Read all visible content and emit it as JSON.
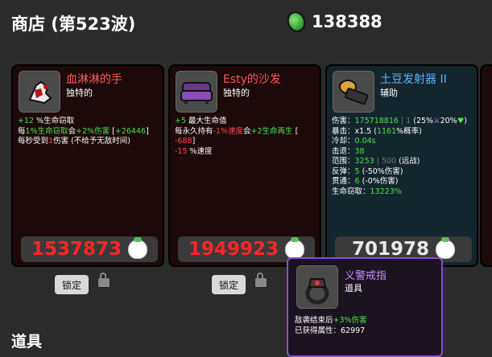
{
  "header": {
    "title": "商店 (第523波)",
    "materials": "138388"
  },
  "cards": [
    {
      "name": "血淋淋的手",
      "type": "独特的",
      "price": "1537873",
      "lines": [
        [
          {
            "t": "+12",
            "c": "g"
          },
          {
            "t": " %生命窃取"
          }
        ],
        [
          {
            "t": "每"
          },
          {
            "t": "1%生命窃取",
            "c": "g"
          },
          {
            "t": "会"
          },
          {
            "t": "+2%伤害",
            "c": "g"
          },
          {
            "t": " ["
          },
          {
            "t": "+26446",
            "c": "g"
          },
          {
            "t": "]"
          }
        ],
        [
          {
            "t": "每秒受到"
          },
          {
            "t": "1",
            "c": "r"
          },
          {
            "t": "伤害 (不给予无敌时间)"
          }
        ]
      ]
    },
    {
      "name": "Esty的沙发",
      "type": "独特的",
      "price": "1949923",
      "lines": [
        [
          {
            "t": "+5",
            "c": "g"
          },
          {
            "t": " 最大生命值"
          }
        ],
        [
          {
            "t": "每永久持有"
          },
          {
            "t": "-1%速度",
            "c": "r"
          },
          {
            "t": "会"
          },
          {
            "t": "+2生命再生",
            "c": "g"
          },
          {
            "t": " ["
          }
        ],
        [
          {
            "t": "-688",
            "c": "r"
          },
          {
            "t": "]"
          }
        ],
        [
          {
            "t": "-15",
            "c": "r"
          },
          {
            "t": " %速度"
          }
        ]
      ]
    },
    {
      "name": "土豆发射器 II",
      "type": "辅助",
      "price": "701978",
      "lines": [
        [
          {
            "t": "伤害：",
            "c": ""
          },
          {
            "t": "175718816",
            "c": "g"
          },
          {
            "t": " | 1",
            "c": "dim"
          },
          {
            "t": " (25%"
          },
          {
            "t": "⚔",
            "c": "pu"
          },
          {
            "t": "20%"
          },
          {
            "t": "♥",
            "c": "g"
          },
          {
            "t": ")"
          }
        ],
        [
          {
            "t": "暴击：x1.5 ("
          },
          {
            "t": "1161",
            "c": "g"
          },
          {
            "t": "%概率)"
          }
        ],
        [
          {
            "t": "冷却："
          },
          {
            "t": "0.04s",
            "c": "g"
          }
        ],
        [
          {
            "t": "击退："
          },
          {
            "t": "38",
            "c": "g"
          }
        ],
        [
          {
            "t": "范围："
          },
          {
            "t": "3253",
            "c": "g"
          },
          {
            "t": " | 500",
            "c": "dim"
          },
          {
            "t": " (远战)"
          }
        ],
        [
          {
            "t": "反弹："
          },
          {
            "t": "5",
            "c": "g"
          },
          {
            "t": " (-50%伤害)"
          }
        ],
        [
          {
            "t": "贯通："
          },
          {
            "t": "6",
            "c": "g"
          },
          {
            "t": " (-0%伤害)"
          }
        ],
        [
          {
            "t": "生命窃取："
          },
          {
            "t": "13223%",
            "c": "g"
          }
        ]
      ]
    }
  ],
  "lock_label": "锁定",
  "tooltip": {
    "name": "义警戒指",
    "type": "道具",
    "lines": [
      [
        {
          "t": "敌袭结束后"
        },
        {
          "t": "+3%伤害",
          "c": "g"
        }
      ],
      [
        {
          "t": "已获得属性：62997"
        }
      ]
    ]
  },
  "section": {
    "items_title": "道具"
  }
}
